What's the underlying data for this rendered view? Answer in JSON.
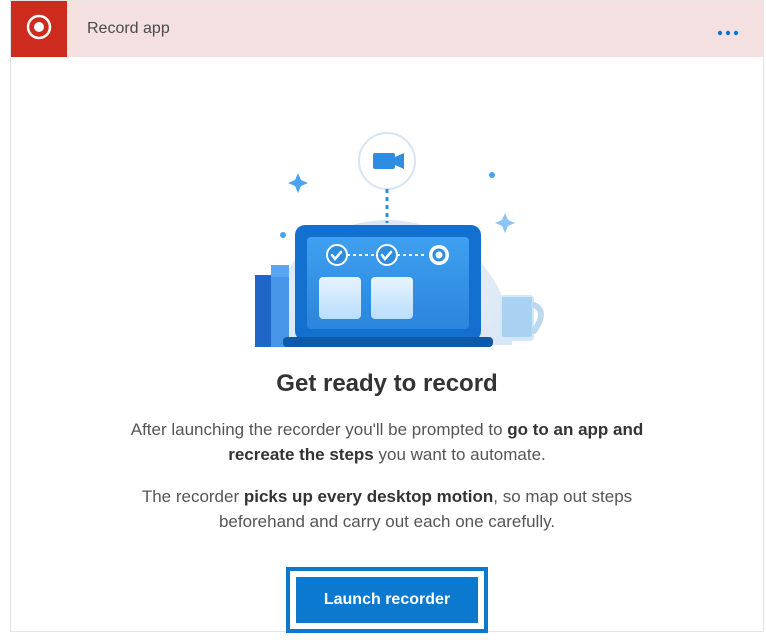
{
  "header": {
    "title": "Record app",
    "icon": "record-icon",
    "more_icon": "more-horizontal-icon"
  },
  "illustration": {
    "camera_icon": "video-camera-icon"
  },
  "main": {
    "heading": "Get ready to record",
    "p1_a": "After launching the recorder you'll be prompted to ",
    "p1_b": "go to an app and recreate the steps",
    "p1_c": " you want to automate.",
    "p2_a": "The recorder ",
    "p2_b": "picks up every desktop motion",
    "p2_c": ", so map out steps beforehand and carry out each one carefully."
  },
  "button": {
    "launch_label": "Launch recorder"
  },
  "colors": {
    "accent": "#0b79d0",
    "header_bg": "#f5e0e1",
    "record_red": "#cc2b1d"
  }
}
